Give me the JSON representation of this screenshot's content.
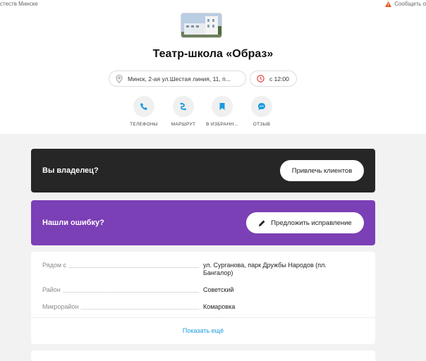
{
  "topbar": {
    "left_text": "стеств Минске",
    "report_label": "Сообщить о",
    "report_icon": "warning-triangle-icon"
  },
  "place": {
    "title": "Театр-школа «Образ»",
    "address": "Минск, 2-ая ул.Шестая линия, 11, п...",
    "hours": "с 12:00"
  },
  "actions": [
    {
      "label": "ТЕЛЕФОНЫ",
      "icon": "phone-icon"
    },
    {
      "label": "МАРШРУТ",
      "icon": "route-icon"
    },
    {
      "label": "В ИЗБРАНН...",
      "icon": "bookmark-icon"
    },
    {
      "label": "ОТЗЫВ",
      "icon": "chat-icon"
    }
  ],
  "owner_card": {
    "title": "Вы владелец?",
    "button": "Привлечь клиентов"
  },
  "error_card": {
    "title": "Нашли ошибку?",
    "button": "Предложить исправление"
  },
  "info": {
    "rows": [
      {
        "key": "Рядом с",
        "value": "ул. Сурганова, парк Дружбы Народов (пл. Бангалор)"
      },
      {
        "key": "Район",
        "value": "Советский"
      },
      {
        "key": "Микрорайон",
        "value": "Комаровка"
      }
    ],
    "show_more": "Показать ещё"
  },
  "colors": {
    "accent_blue": "#1a9be0",
    "owner_bg": "#262626",
    "error_bg": "#7b3fb6",
    "warning": "#e8541e"
  }
}
